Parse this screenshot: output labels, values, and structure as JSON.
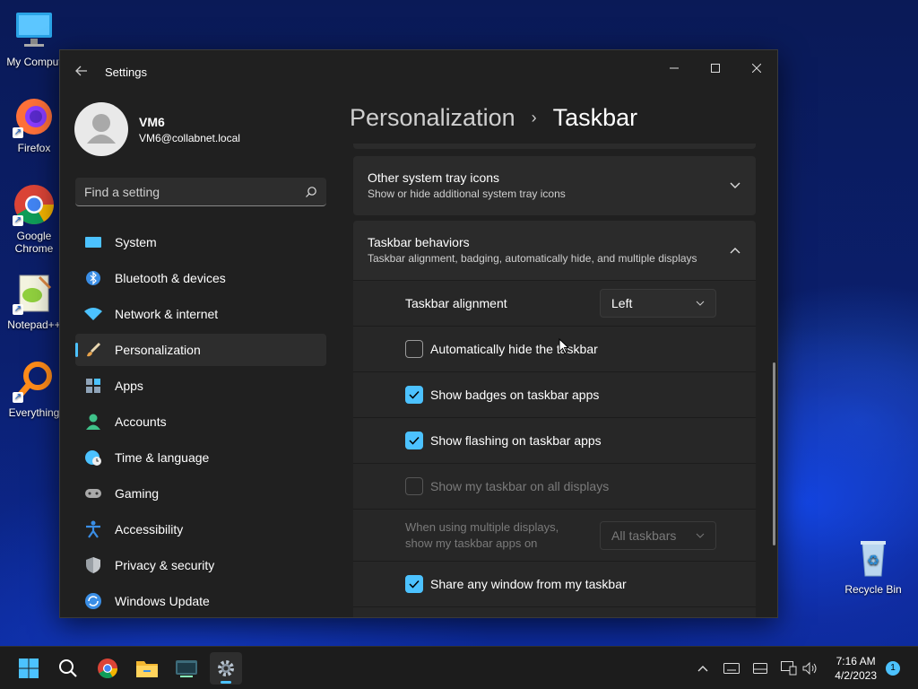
{
  "desktop": {
    "icons": [
      {
        "label": "My Comput",
        "icon": "monitor-icon"
      },
      {
        "label": "Firefox",
        "icon": "firefox-icon"
      },
      {
        "label": "Google Chrome",
        "icon": "chrome-icon"
      },
      {
        "label": "Notepad++",
        "icon": "notepadpp-icon"
      },
      {
        "label": "Everything",
        "icon": "search-magnifier-icon"
      },
      {
        "label": "Recycle Bin",
        "icon": "recycle-bin-icon"
      }
    ]
  },
  "window": {
    "title": "Settings",
    "profile": {
      "name": "VM6",
      "email": "VM6@collabnet.local"
    },
    "search": {
      "placeholder": "Find a setting"
    },
    "nav": [
      {
        "label": "System",
        "icon": "system-icon",
        "color": "#4cc2ff"
      },
      {
        "label": "Bluetooth & devices",
        "icon": "bluetooth-icon",
        "color": "#3a8ee6"
      },
      {
        "label": "Network & internet",
        "icon": "wifi-icon",
        "color": "#4cc2ff"
      },
      {
        "label": "Personalization",
        "icon": "brush-icon",
        "color": "#e8a24a",
        "active": true
      },
      {
        "label": "Apps",
        "icon": "apps-icon",
        "color": "#8fa3b8"
      },
      {
        "label": "Accounts",
        "icon": "accounts-icon",
        "color": "#3fc28a"
      },
      {
        "label": "Time & language",
        "icon": "clock-globe-icon",
        "color": "#4cc2ff"
      },
      {
        "label": "Gaming",
        "icon": "gamepad-icon",
        "color": "#aaaaaa"
      },
      {
        "label": "Accessibility",
        "icon": "accessibility-icon",
        "color": "#3a8ee6"
      },
      {
        "label": "Privacy & security",
        "icon": "shield-icon",
        "color": "#9aa0a6"
      },
      {
        "label": "Windows Update",
        "icon": "update-icon",
        "color": "#3a8ee6"
      }
    ],
    "breadcrumb": {
      "parent": "Personalization",
      "separator": "›",
      "current": "Taskbar"
    },
    "sections": {
      "tray": {
        "title": "Other system tray icons",
        "subtitle": "Show or hide additional system tray icons"
      },
      "behaviors": {
        "title": "Taskbar behaviors",
        "subtitle": "Taskbar alignment, badging, automatically hide, and multiple displays",
        "alignment_label": "Taskbar alignment",
        "alignment_value": "Left",
        "options": [
          {
            "label": "Automatically hide the taskbar",
            "checked": false,
            "disabled": false
          },
          {
            "label": "Show badges on taskbar apps",
            "checked": true,
            "disabled": false
          },
          {
            "label": "Show flashing on taskbar apps",
            "checked": true,
            "disabled": false
          },
          {
            "label": "Show my taskbar on all displays",
            "checked": false,
            "disabled": true
          }
        ],
        "multi_display_label_1": "When using multiple displays,",
        "multi_display_label_2": "show my taskbar apps on",
        "multi_display_value": "All taskbars",
        "share_label": "Share any window from my taskbar",
        "share_checked": true
      }
    }
  },
  "taskbar": {
    "pinned": [
      "start-icon",
      "search-icon",
      "chrome-icon",
      "file-explorer-icon",
      "terminal-icon",
      "settings-gear-icon"
    ],
    "clock_time": "7:16 AM",
    "clock_date": "4/2/2023",
    "notification_count": "1",
    "accent": "#4cc2ff"
  }
}
